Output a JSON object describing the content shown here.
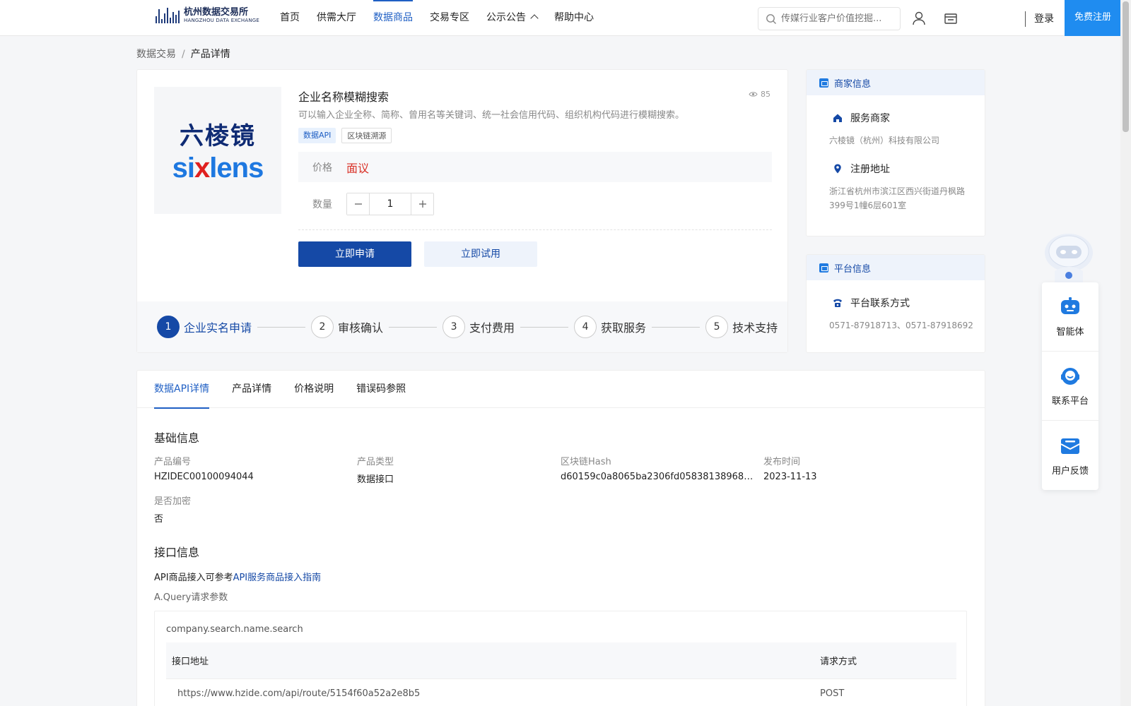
{
  "header": {
    "logo_cn": "杭州数据交易所",
    "logo_en": "HANGZHOU DATA EXCHANGE",
    "nav": [
      "首页",
      "供需大厅",
      "数据商品",
      "交易专区",
      "公示公告",
      "帮助中心"
    ],
    "search_placeholder": "传媒行业客户价值挖掘...",
    "login": "登录",
    "register": "免费注册"
  },
  "breadcrumb": {
    "root": "数据交易",
    "separator": "/",
    "current": "产品详情"
  },
  "product": {
    "logo_cn": "六棱镜",
    "logo_en_a": "si",
    "logo_en_b": "x",
    "logo_en_c": "lens",
    "title": "企业名称模糊搜索",
    "views": "85",
    "description": "可以输入企业全称、简称、曾用名等关键词、统一社会信用代码、组织机构代码进行模糊搜索。",
    "tags": [
      "数据API",
      "区块链溯源"
    ],
    "price_label": "价格",
    "price_value": "面议",
    "qty_label": "数量",
    "qty_value": "1",
    "apply_btn": "立即申请",
    "trial_btn": "立即试用",
    "steps": [
      {
        "num": "1",
        "label": "企业实名申请"
      },
      {
        "num": "2",
        "label": "审核确认"
      },
      {
        "num": "3",
        "label": "支付费用"
      },
      {
        "num": "4",
        "label": "获取服务"
      },
      {
        "num": "5",
        "label": "技术支持"
      }
    ]
  },
  "merchant": {
    "head": "商家信息",
    "service_title": "服务商家",
    "service_value": "六棱镜（杭州）科技有限公司",
    "address_title": "注册地址",
    "address_value": "浙江省杭州市滨江区西兴街道丹枫路399号1幢6层601室"
  },
  "platform": {
    "head": "平台信息",
    "contact_title": "平台联系方式",
    "contact_value": "0571-87918713、0571-87918692"
  },
  "float_tools": [
    "智能体",
    "联系平台",
    "用户反馈"
  ],
  "details": {
    "tabs": [
      "数据API详情",
      "产品详情",
      "价格说明",
      "错误码参照"
    ],
    "basic_title": "基础信息",
    "fields": [
      {
        "k": "产品编号",
        "v": "HZIDEC00100094044"
      },
      {
        "k": "产品类型",
        "v": "数据接口"
      },
      {
        "k": "区块链Hash",
        "v": "d60159c0a8065ba2306fd058381389686d..."
      },
      {
        "k": "发布时间",
        "v": "2023-11-13"
      },
      {
        "k": "是否加密",
        "v": "否"
      }
    ],
    "api_title": "接口信息",
    "api_guide_prefix": "API商品接入可参考",
    "api_guide_link": "API服务商品接入指南",
    "query_label": "A.Query请求参数",
    "api_name": "company.search.name.search",
    "th_url": "接口地址",
    "th_method": "请求方式",
    "url": "https://www.hzide.com/api/route/5154f60a52a2e8b5",
    "method": "POST"
  },
  "colors": {
    "primary": "#1549a6",
    "accent": "#1f5fc4",
    "price": "#d93026",
    "register": "#1f8cf0"
  }
}
